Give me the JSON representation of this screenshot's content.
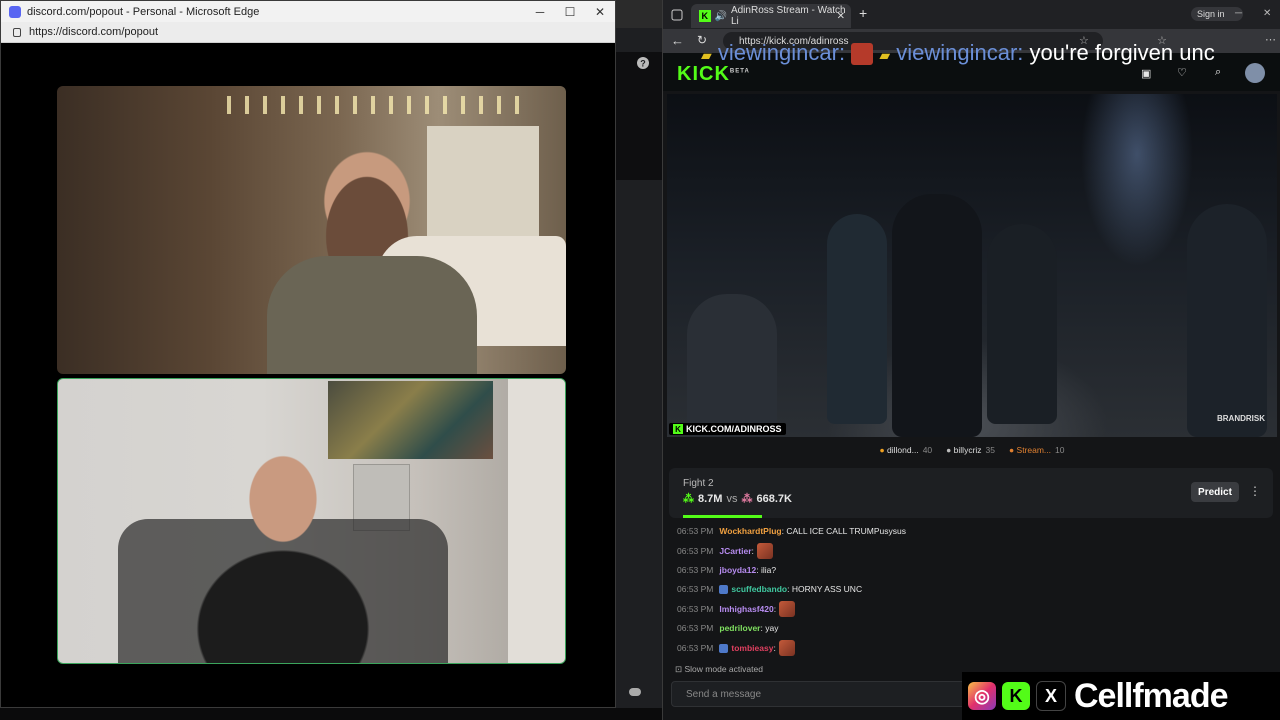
{
  "discord_window": {
    "title": "discord.com/popout - Personal - Microsoft Edge",
    "url": "https://discord.com/popout",
    "controls": {
      "minimize": "─",
      "maximize": "☐",
      "close": "✕"
    }
  },
  "browser": {
    "tab_title": "AdinRoss Stream - Watch Li",
    "url": "https://kick.com/adinross",
    "sign_in": "Sign in",
    "kick_logo": "KICK",
    "kick_logo_badge": "BETA",
    "new_tab": "+"
  },
  "overlay_chat": {
    "user1": "viewingincar:",
    "user2": "viewingincar:",
    "text": "you're forgiven unc"
  },
  "video": {
    "watermark": "KICK.COM/ADINROSS",
    "brand": "BRANDRISK"
  },
  "gifters": [
    {
      "name": "dillond...",
      "count": "40",
      "color": "#f0a020"
    },
    {
      "name": "billycriz",
      "count": "35",
      "color": "#bbbbbb"
    },
    {
      "name": "Stream...",
      "count": "10",
      "color": "#e08030"
    }
  ],
  "prediction": {
    "title": "Fight 2",
    "left_value": "8.7M",
    "vs": "vs",
    "right_value": "668.7K",
    "button": "Predict",
    "more": "⋮",
    "progress": 0.13
  },
  "chat": [
    {
      "time": "06:53 PM",
      "user": "WockhardtPlug",
      "color": "#f0a040",
      "text": "CALL ICE CALL TRUMPusysus",
      "emote": false,
      "badge": false
    },
    {
      "time": "06:53 PM",
      "user": "JCartier",
      "color": "#b78cf0",
      "text": "",
      "emote": true,
      "badge": false
    },
    {
      "time": "06:53 PM",
      "user": "jboyda12",
      "color": "#b78cf0",
      "text": "ilia?",
      "emote": false,
      "badge": false
    },
    {
      "time": "06:53 PM",
      "user": "scuffedbando",
      "color": "#40c8a0",
      "text": "HORNY ASS UNC",
      "emote": false,
      "badge": true
    },
    {
      "time": "06:53 PM",
      "user": "Imhighasf420",
      "color": "#b78cf0",
      "text": "",
      "emote": true,
      "badge": false
    },
    {
      "time": "06:53 PM",
      "user": "pedrilover",
      "color": "#7fe060",
      "text": "yay",
      "emote": false,
      "badge": false
    },
    {
      "time": "06:53 PM",
      "user": "tombieasy",
      "color": "#e04060",
      "text": "",
      "emote": true,
      "badge": true
    }
  ],
  "slow_mode": "Slow mode activated",
  "send_placeholder": "Send a message",
  "social_handle": "Cellfmade",
  "colors": {
    "kick_green": "#53fc18",
    "discord_speaking": "#3ba55c"
  }
}
